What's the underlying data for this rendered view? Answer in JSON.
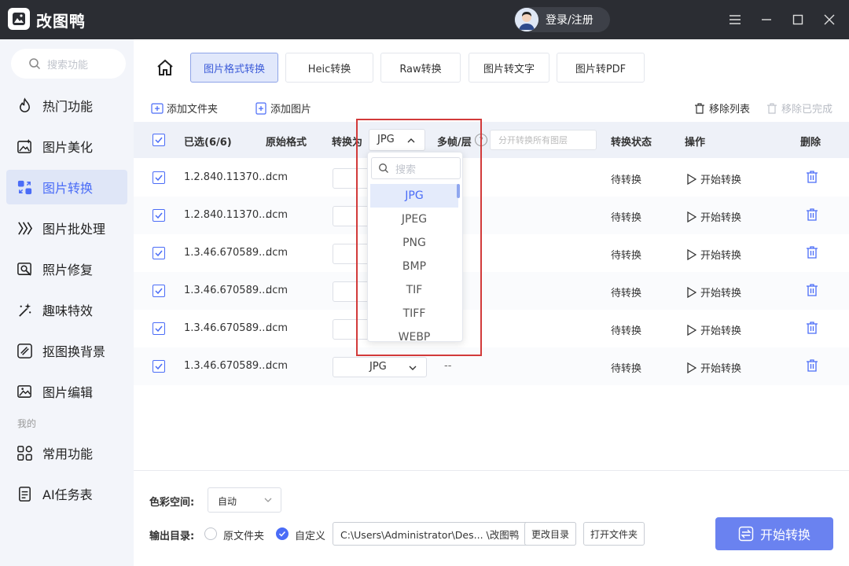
{
  "app": {
    "name": "改图鸭",
    "login_label": "登录/注册"
  },
  "sidebar": {
    "search_placeholder": "搜索功能",
    "items": [
      {
        "label": "热门功能",
        "icon": "flame-icon"
      },
      {
        "label": "图片美化",
        "icon": "image-sparkle-icon"
      },
      {
        "label": "图片转换",
        "icon": "convert-icon",
        "active": true
      },
      {
        "label": "图片批处理",
        "icon": "batch-icon"
      },
      {
        "label": "照片修复",
        "icon": "photo-repair-icon"
      },
      {
        "label": "趣味特效",
        "icon": "magic-wand-icon"
      },
      {
        "label": "抠图换背景",
        "icon": "cutout-icon"
      },
      {
        "label": "图片编辑",
        "icon": "image-edit-icon"
      }
    ],
    "section_mine": "我的",
    "mine_items": [
      {
        "label": "常用功能",
        "icon": "grid-icon"
      },
      {
        "label": "AI任务表",
        "icon": "document-icon"
      }
    ]
  },
  "tabs": [
    {
      "label": "图片格式转换",
      "active": true
    },
    {
      "label": "Heic转换"
    },
    {
      "label": "Raw转换"
    },
    {
      "label": "图片转文字"
    },
    {
      "label": "图片转PDF"
    }
  ],
  "actions": {
    "add_folder": "添加文件夹",
    "add_image": "添加图片",
    "remove_list": "移除列表",
    "remove_done": "移除已完成"
  },
  "table": {
    "headers": {
      "selected": "已选(6/6)",
      "original_format": "原始格式",
      "convert_to": "转换为",
      "convert_to_value": "JPG",
      "multi_frame": "多帧/层",
      "split_placeholder": "分开转换所有图层",
      "status": "转换状态",
      "operation": "操作",
      "delete": "删除"
    },
    "rows": [
      {
        "name": "1.2.840.11370...",
        "format": "dcm",
        "target": "",
        "frames": "",
        "status": "待转换",
        "action": "开始转换"
      },
      {
        "name": "1.2.840.11370...",
        "format": "dcm",
        "target": "",
        "frames": "",
        "status": "待转换",
        "action": "开始转换"
      },
      {
        "name": "1.3.46.670589...",
        "format": "dcm",
        "target": "",
        "frames": "",
        "status": "待转换",
        "action": "开始转换"
      },
      {
        "name": "1.3.46.670589...",
        "format": "dcm",
        "target": "",
        "frames": "",
        "status": "待转换",
        "action": "开始转换"
      },
      {
        "name": "1.3.46.670589...",
        "format": "dcm",
        "target": "",
        "frames": "",
        "status": "待转换",
        "action": "开始转换"
      },
      {
        "name": "1.3.46.670589...",
        "format": "dcm",
        "target": "JPG",
        "frames": "--",
        "status": "待转换",
        "action": "开始转换"
      }
    ]
  },
  "dropdown": {
    "search_placeholder": "搜索",
    "options": [
      "JPG",
      "JPEG",
      "PNG",
      "BMP",
      "TIF",
      "TIFF",
      "WEBP"
    ],
    "selected": "JPG"
  },
  "bottom": {
    "color_space_label": "色彩空间:",
    "color_space_value": "自动",
    "output_label": "输出目录:",
    "radio_original": "原文件夹",
    "radio_custom": "自定义",
    "path": "C:\\Users\\Administrator\\Des... \\改图鸭",
    "change_dir": "更改目录",
    "open_folder": "打开文件夹",
    "start_all": "开始转换"
  },
  "colors": {
    "accent": "#4a6cf7",
    "titlebar": "#2b2d33",
    "highlight_frame": "#d23a3a"
  }
}
